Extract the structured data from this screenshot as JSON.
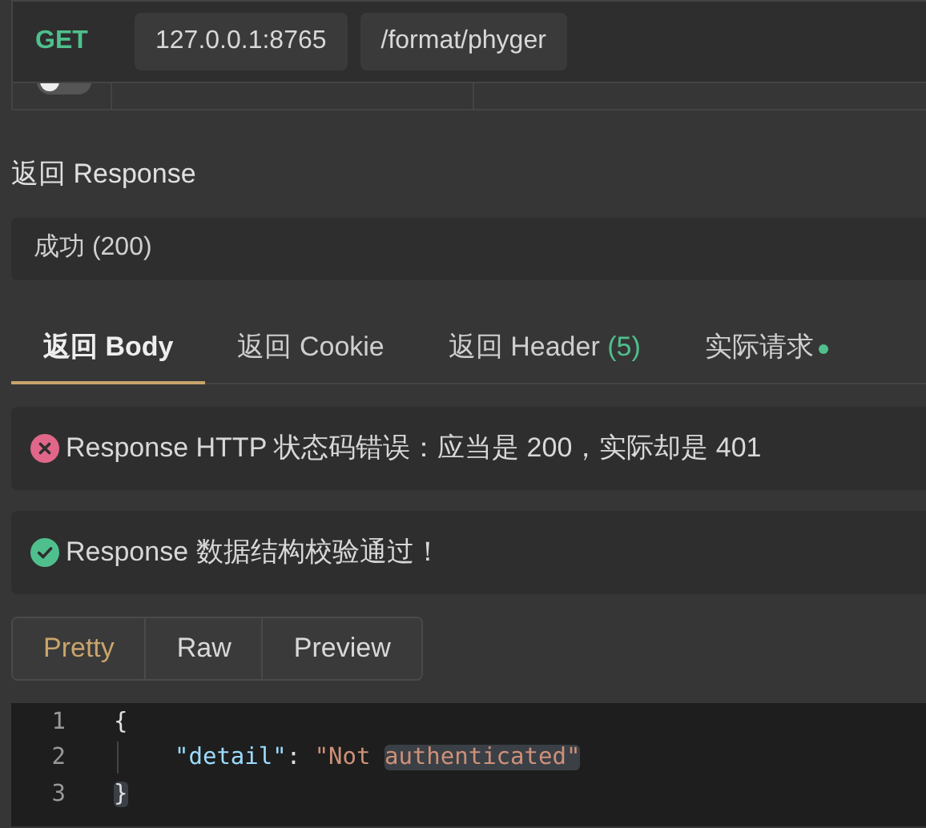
{
  "request_bar": {
    "method": "GET",
    "host": "127.0.0.1:8765",
    "path": "/format/phyger"
  },
  "toggle": {
    "on": false
  },
  "response_label": "返回 Response",
  "status_field": {
    "value": "成功 (200)"
  },
  "tabs": [
    {
      "label": "返回 Body",
      "selected": true
    },
    {
      "label": "返回 Cookie",
      "selected": false
    },
    {
      "label": "返回 Header",
      "count": "(5)",
      "selected": false
    },
    {
      "label": "实际请求",
      "dot": true,
      "selected": false
    }
  ],
  "assertions": [
    {
      "kind": "error",
      "text": "Response HTTP 状态码错误：应当是 200，实际却是 401"
    },
    {
      "kind": "success",
      "text": "Response 数据结构校验通过！"
    }
  ],
  "view_modes": [
    {
      "label": "Pretty",
      "selected": true
    },
    {
      "label": "Raw",
      "selected": false
    },
    {
      "label": "Preview",
      "selected": false
    }
  ],
  "code": [
    {
      "number": "1",
      "tokens": [
        {
          "kind": "punct",
          "text": "{"
        }
      ]
    },
    {
      "number": "2",
      "tokens": [
        {
          "kind": "key",
          "text": "\"detail\""
        },
        {
          "kind": "punct",
          "text": ": "
        },
        {
          "kind": "string",
          "text": "\"Not "
        },
        {
          "kind": "string",
          "text": "authenticated\"",
          "highlighted": true
        }
      ]
    },
    {
      "number": "3",
      "tokens": [
        {
          "kind": "punct",
          "text": "}",
          "highlighted": true
        }
      ]
    }
  ]
}
